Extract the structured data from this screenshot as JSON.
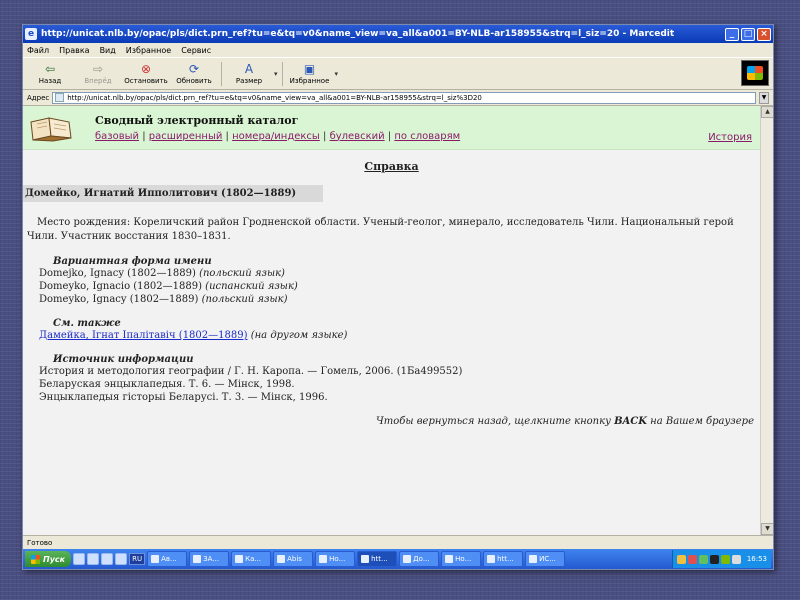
{
  "window": {
    "title": "http://unicat.nlb.by/opac/pls/dict.prn_ref?tu=e&tq=v0&name_view=va_all&a001=BY-NLB-ar158955&strq=l_siz=20 - Marcedit"
  },
  "menu": [
    "Файл",
    "Правка",
    "Вид",
    "Избранное",
    "Сервис"
  ],
  "toolbar": {
    "back": "Назад",
    "forward": "Вперёд",
    "stop": "Остановить",
    "refresh": "Обновить",
    "size": "Размер",
    "favorites": "Избранное"
  },
  "address": {
    "label": "Адрес",
    "value": "http://unicat.nlb.by/opac/pls/dict.prn_ref?tu=e&tq=v0&name_view=va_all&a001=BY-NLB-ar158955&strq=l_siz%3D20"
  },
  "catalog": {
    "title": "Сводный электронный каталог",
    "links": [
      "базовый",
      "расширенный",
      "номера/индексы",
      "булевский",
      "по словарям"
    ],
    "history": "История"
  },
  "doc": {
    "help_title": "Справка",
    "person": "Домейко, Игнатий Ипполитович (1802—1889)",
    "bio": "Место рождения: Кореличский район Гродненской области. Ученый-геолог, минерало, исследователь Чили. Национальный герой Чили. Участник восстания 1830–1831.",
    "variant_title": "Вариантная форма имени",
    "variants": [
      {
        "name": "Domejko, Ignacy (1802—1889)",
        "lang": "(польский язык)"
      },
      {
        "name": "Domeyko, Ignacio (1802—1889)",
        "lang": "(испанский язык)"
      },
      {
        "name": "Domeyko, Ignacy (1802—1889)",
        "lang": "(польский язык)"
      }
    ],
    "see_also_title": "См. также",
    "see_also_link": "Дамейка, Ігнат Іпалітавіч (1802—1889)",
    "see_also_note": "(на другом языке)",
    "source_title": "Источник информации",
    "sources": [
      "История и методология географии / Г. Н. Каропа. — Гомель, 2006. (1Ба499552)",
      "Беларуская энцыклапедыя. Т. 6. — Мінск, 1998.",
      "Энцыклапедыя гісторыі Беларусі. Т. 3. — Мінск, 1996."
    ],
    "back_note_pre": "Чтобы вернуться назад, щелкните кнопку",
    "back_note_key": "BACK",
    "back_note_post": "на Вашем браузере"
  },
  "status": "Готово",
  "taskbar": {
    "start": "Пуск",
    "lang": "RU",
    "tasks": [
      "Ав...",
      "ЗА...",
      "Ка...",
      "Abis",
      "Но...",
      "htt...",
      "До...",
      "Но...",
      "htt...",
      "ИС..."
    ],
    "active_index": 5,
    "clock": "16:53"
  }
}
